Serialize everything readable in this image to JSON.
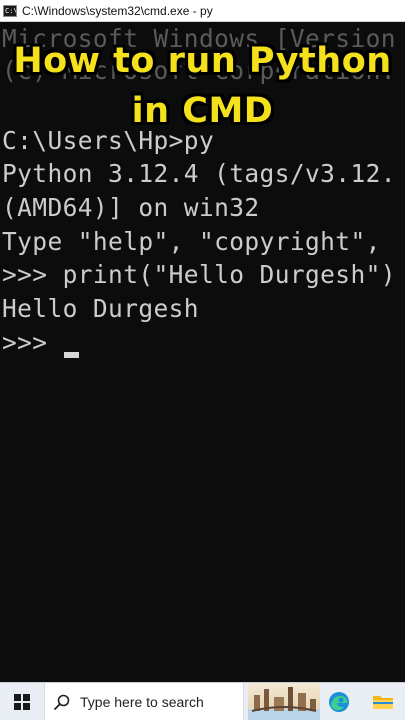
{
  "window": {
    "title": "C:\\Windows\\system32\\cmd.exe - py",
    "icon_text": "C:\\"
  },
  "console": {
    "lines": [
      "Microsoft Windows [Version",
      "(c) Microsoft Corporation.",
      "",
      "C:\\Users\\Hp>py",
      "Python 3.12.4 (tags/v3.12.",
      "(AMD64)] on win32",
      "Type \"help\", \"copyright\",",
      ">>> print(\"Hello Durgesh\")",
      "Hello Durgesh",
      ">>> "
    ]
  },
  "caption": {
    "line1": "How to run Python",
    "line2": "in CMD",
    "color": "#f5e11b"
  },
  "taskbar": {
    "search_placeholder": "Type here to search",
    "start_icon": "windows-logo-icon",
    "pinned": [
      "edge-icon",
      "file-explorer-icon"
    ]
  },
  "colors": {
    "console_bg": "#0c0c0c",
    "console_text": "#cccccc",
    "taskbar_bg": "#e9eef4"
  }
}
